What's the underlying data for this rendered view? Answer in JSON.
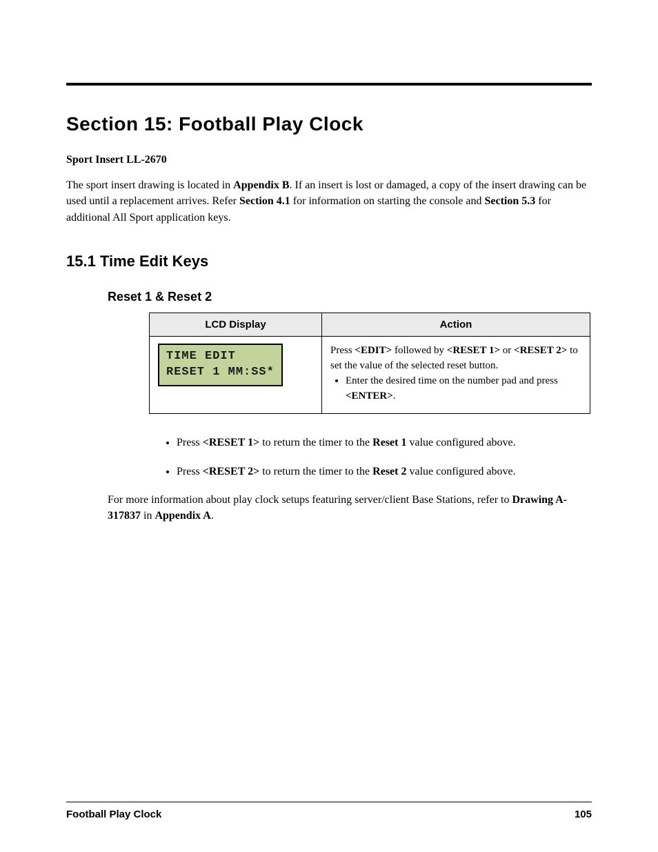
{
  "section": {
    "number": "Section 15:",
    "title": "Football Play Clock",
    "sport_insert_sentence_prefix": "Sport Insert LL-2670",
    "intro_pre": "The sport insert drawing is located in ",
    "intro_appendix_b": "Appendix B",
    "intro_mid1": ". If an insert is lost or damaged, a copy of the insert drawing can be used until a replacement arrives. Refer ",
    "intro_sec41": "Section 4.1",
    "intro_mid2": " for information on starting the console and ",
    "intro_sec53": "Section 5.3",
    "intro_post": " for additional All Sport application keys."
  },
  "h2_15_1": "15.1 Time Edit Keys",
  "h3_reset12": "Reset 1 & Reset 2",
  "table": {
    "header_lcd": "LCD Display",
    "header_action": "Action",
    "lcd_line1": "TIME EDIT",
    "lcd_line2": "RESET 1 MM:SS*",
    "action_intro": "Press ",
    "action_btn": "<EDIT>",
    "action_followed_prefix": " followed by ",
    "action_r1": "<RESET 1>",
    "action_or": " or ",
    "action_r2": "<RESET 2>",
    "action_to_set": " to set the value of the selected reset button.",
    "action_bullet1_pre": "Enter the desired time on the number pad and press ",
    "action_bullet1_enter": "<ENTER>",
    "action_bullet1_post": "."
  },
  "resets": {
    "r1_pre": "Press ",
    "r1_btn": "<RESET 1>",
    "r1_mid": " to return the timer to the ",
    "r1_val": "Reset 1",
    "r1_post": " value configured above.",
    "r2_pre": "Press ",
    "r2_btn": "<RESET 2>",
    "r2_mid": " to return the timer to the ",
    "r2_val": "Reset 2",
    "r2_post": " value configured above."
  },
  "closing": {
    "pre": "For more information about play clock setups featuring server/client Base Stations, refer to ",
    "drawing": "Drawing A-317837",
    "in": " in ",
    "appendix_a": "Appendix A",
    "post": "."
  },
  "footer": {
    "left": "Football Play Clock",
    "right": "105"
  }
}
